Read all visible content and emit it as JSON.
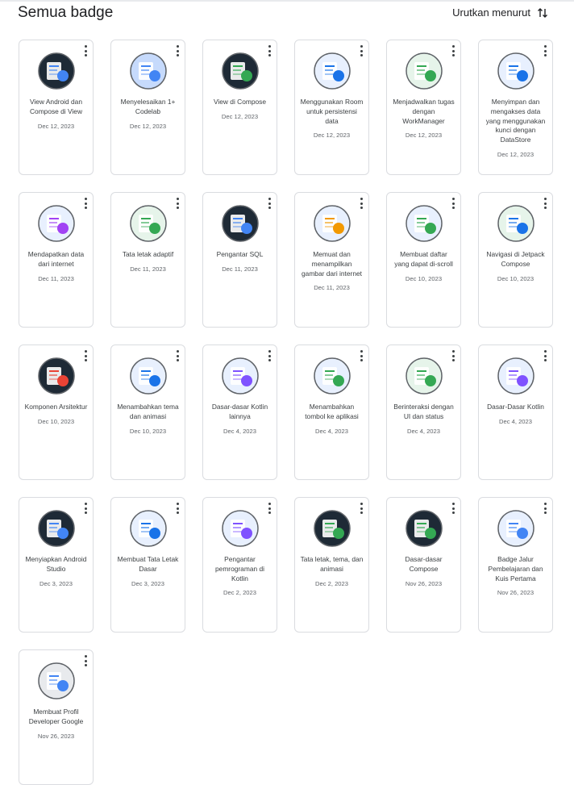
{
  "header": {
    "title": "Semua badge",
    "sort_label": "Urutkan menurut"
  },
  "badges": [
    {
      "name": "View Android dan Compose di View",
      "date": "Dec 12, 2023",
      "icon": "android-compose-badge-icon",
      "bg": "#1e2a36",
      "accent": "#4285f4"
    },
    {
      "name": "Menyelesaikan 1+ Codelab",
      "date": "Dec 12, 2023",
      "icon": "codelab-badge-icon",
      "bg": "#c6dafc",
      "accent": "#4285f4"
    },
    {
      "name": "View di Compose",
      "date": "Dec 12, 2023",
      "icon": "view-compose-badge-icon",
      "bg": "#1e2a36",
      "accent": "#34a853"
    },
    {
      "name": "Menggunakan Room untuk persistensi data",
      "date": "Dec 12, 2023",
      "icon": "room-database-badge-icon",
      "bg": "#e8f0fe",
      "accent": "#1a73e8"
    },
    {
      "name": "Menjadwalkan tugas dengan WorkManager",
      "date": "Dec 12, 2023",
      "icon": "workmanager-badge-icon",
      "bg": "#e6f4ea",
      "accent": "#34a853"
    },
    {
      "name": "Menyimpan dan mengakses data yang menggunakan kunci dengan DataStore",
      "date": "Dec 12, 2023",
      "icon": "datastore-badge-icon",
      "bg": "#e8f0fe",
      "accent": "#1a73e8"
    },
    {
      "name": "Mendapatkan data dari internet",
      "date": "Dec 11, 2023",
      "icon": "internet-data-badge-icon",
      "bg": "#e8f0fe",
      "accent": "#a142f4"
    },
    {
      "name": "Tata letak adaptif",
      "date": "Dec 11, 2023",
      "icon": "adaptive-layout-badge-icon",
      "bg": "#e6f4ea",
      "accent": "#34a853"
    },
    {
      "name": "Pengantar SQL",
      "date": "Dec 11, 2023",
      "icon": "sql-badge-icon",
      "bg": "#1e2a36",
      "accent": "#4285f4"
    },
    {
      "name": "Memuat dan menampilkan gambar dari internet",
      "date": "Dec 11, 2023",
      "icon": "load-images-badge-icon",
      "bg": "#e8f0fe",
      "accent": "#f29900"
    },
    {
      "name": "Membuat daftar yang dapat di-scroll",
      "date": "Dec 10, 2023",
      "icon": "scrollable-list-badge-icon",
      "bg": "#e8f0fe",
      "accent": "#34a853"
    },
    {
      "name": "Navigasi di Jetpack Compose",
      "date": "Dec 10, 2023",
      "icon": "navigation-badge-icon",
      "bg": "#e6f4ea",
      "accent": "#1a73e8"
    },
    {
      "name": "Komponen Arsitektur",
      "date": "Dec 10, 2023",
      "icon": "architecture-badge-icon",
      "bg": "#1e2a36",
      "accent": "#ea4335"
    },
    {
      "name": "Menambahkan tema dan animasi",
      "date": "Dec 10, 2023",
      "icon": "theme-animation-badge-icon",
      "bg": "#e8f0fe",
      "accent": "#1a73e8"
    },
    {
      "name": "Dasar-dasar Kotlin lainnya",
      "date": "Dec 4, 2023",
      "icon": "kotlin-more-badge-icon",
      "bg": "#e8f0fe",
      "accent": "#7f52ff"
    },
    {
      "name": "Menambahkan tombol ke aplikasi",
      "date": "Dec 4, 2023",
      "icon": "add-button-badge-icon",
      "bg": "#e8f0fe",
      "accent": "#34a853"
    },
    {
      "name": "Berinteraksi dengan UI dan status",
      "date": "Dec 4, 2023",
      "icon": "ui-state-badge-icon",
      "bg": "#e6f4ea",
      "accent": "#34a853"
    },
    {
      "name": "Dasar-Dasar Kotlin",
      "date": "Dec 4, 2023",
      "icon": "kotlin-basics-badge-icon",
      "bg": "#e8f0fe",
      "accent": "#7f52ff"
    },
    {
      "name": "Menyiapkan Android Studio",
      "date": "Dec 3, 2023",
      "icon": "android-studio-badge-icon",
      "bg": "#1e2a36",
      "accent": "#4285f4"
    },
    {
      "name": "Membuat Tata Letak Dasar",
      "date": "Dec 3, 2023",
      "icon": "basic-layout-badge-icon",
      "bg": "#e8f0fe",
      "accent": "#1a73e8"
    },
    {
      "name": "Pengantar pemrograman di Kotlin",
      "date": "Dec 2, 2023",
      "icon": "kotlin-intro-badge-icon",
      "bg": "#e8f0fe",
      "accent": "#7f52ff"
    },
    {
      "name": "Tata letak, tema, dan animasi",
      "date": "Dec 2, 2023",
      "icon": "layout-theme-badge-icon",
      "bg": "#1e2a36",
      "accent": "#34a853"
    },
    {
      "name": "Dasar-dasar Compose",
      "date": "Nov 26, 2023",
      "icon": "compose-basics-badge-icon",
      "bg": "#1e2a36",
      "accent": "#34a853"
    },
    {
      "name": "Badge Jalur Pembelajaran dan Kuis Pertama",
      "date": "Nov 26, 2023",
      "icon": "pathway-quiz-badge-icon",
      "bg": "#e8f0fe",
      "accent": "#4285f4"
    },
    {
      "name": "Membuat Profil Developer Google",
      "date": "Nov 26, 2023",
      "icon": "developer-profile-badge-icon",
      "bg": "#e8eaed",
      "accent": "#4285f4"
    }
  ]
}
